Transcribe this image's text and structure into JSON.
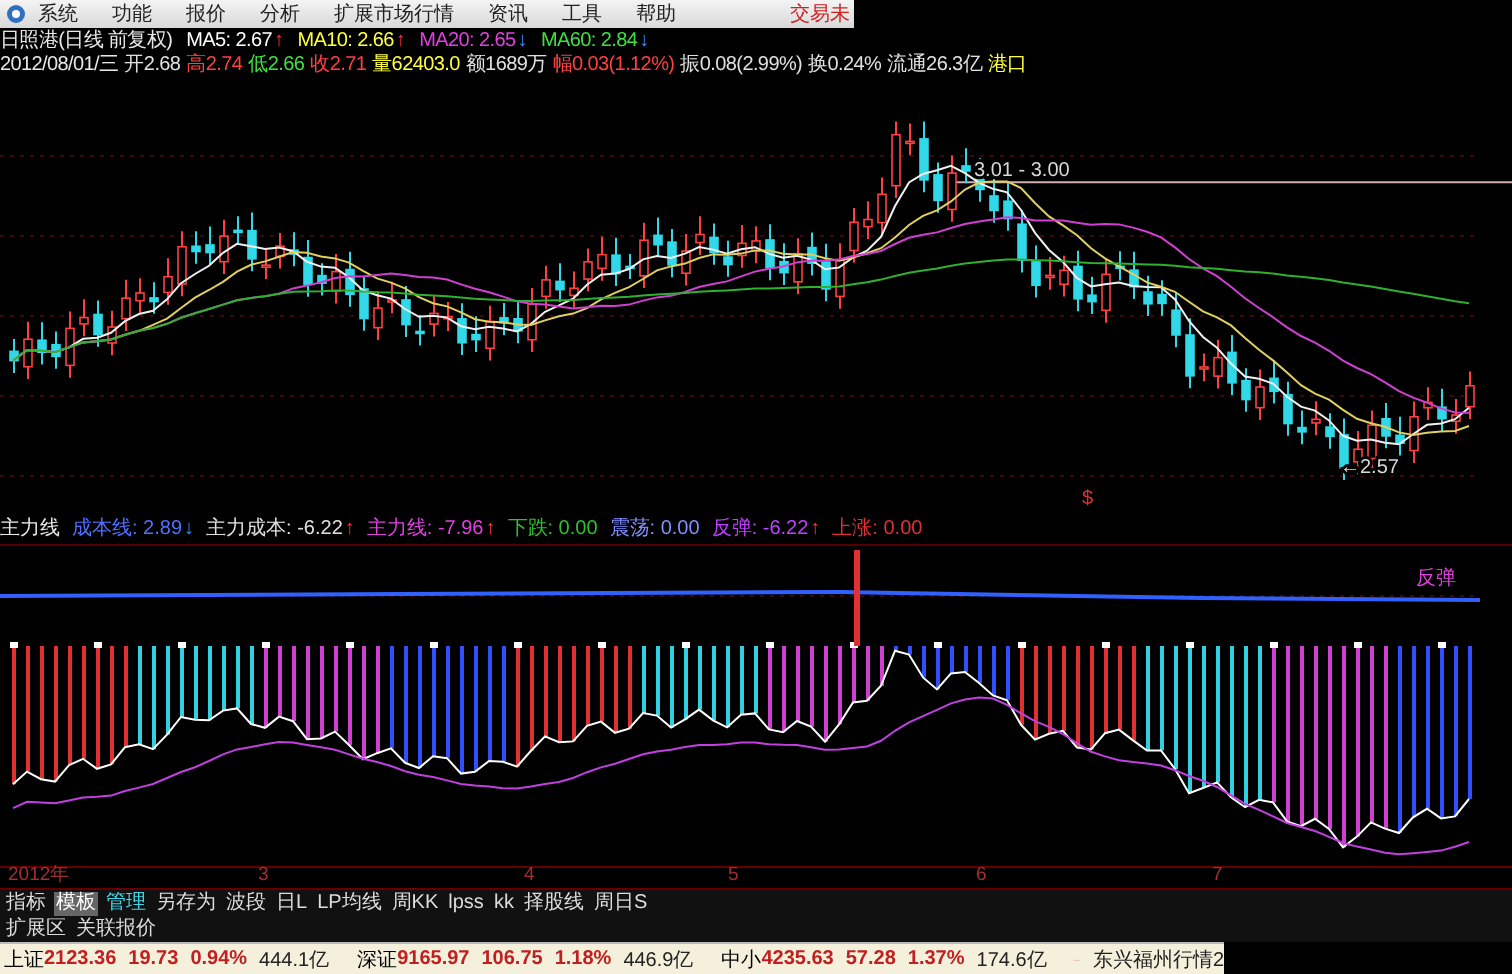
{
  "menu": {
    "items": [
      "系统",
      "功能",
      "报价",
      "分析",
      "扩展市场行情",
      "资讯",
      "工具",
      "帮助"
    ],
    "status": "交易未"
  },
  "header": {
    "title": "日照港(日线 前复权)",
    "moving_averages": [
      {
        "label": "MA5: 2.67",
        "color": "#ffffff",
        "arrow": "↑",
        "rising": true
      },
      {
        "label": "MA10: 2.66",
        "color": "#ffff40",
        "arrow": "↑",
        "rising": true
      },
      {
        "label": "MA20: 2.65",
        "color": "#e040e0",
        "arrow": "↓",
        "rising": false
      },
      {
        "label": "MA60: 2.84",
        "color": "#40e040",
        "arrow": "↓",
        "rising": false
      }
    ]
  },
  "quote_line": {
    "date": "2012/08/01/三",
    "fields": [
      {
        "text": "开2.68",
        "color": "#e0e0e0"
      },
      {
        "text": "高2.74",
        "color": "#ff4040"
      },
      {
        "text": "低2.66",
        "color": "#40e040"
      },
      {
        "text": "收2.71",
        "color": "#ff4040"
      },
      {
        "text": "量62403.0",
        "color": "#ffff40"
      },
      {
        "text": "额1689万",
        "color": "#e0e0e0"
      },
      {
        "text": "幅0.03(1.12%)",
        "color": "#ff4040"
      },
      {
        "text": "振0.08(2.99%)",
        "color": "#e0e0e0"
      },
      {
        "text": "换0.24%",
        "color": "#e0e0e0"
      },
      {
        "text": "流通26.3亿",
        "color": "#e0e0e0"
      },
      {
        "text": "港口",
        "color": "#ffff40"
      }
    ]
  },
  "chart": {
    "annotations": [
      "3.01 - 3.00",
      "←2.57"
    ],
    "marker": "$"
  },
  "indicator": {
    "title": "主力线",
    "items": [
      {
        "label": "成本线:",
        "value": "2.89",
        "color": "#5070ff",
        "arrow": "↓",
        "rising": false
      },
      {
        "label": "主力成本:",
        "value": "-6.22",
        "color": "#e0e0e0",
        "arrow": "↑",
        "rising": true
      },
      {
        "label": "主力线:",
        "value": "-7.96",
        "color": "#e040e0",
        "arrow": "↑",
        "rising": true
      },
      {
        "label": "下跌:",
        "value": "0.00",
        "color": "#30c030"
      },
      {
        "label": "震荡:",
        "value": "0.00",
        "color": "#8090ff"
      },
      {
        "label": "反弹:",
        "value": "-6.22",
        "color": "#c040ff",
        "arrow": "↑",
        "rising": true
      },
      {
        "label": "上涨:",
        "value": "0.00",
        "color": "#e03030"
      }
    ],
    "legend": "反弹"
  },
  "date_axis": [
    "2012年",
    "3",
    "4",
    "5",
    "6",
    "7"
  ],
  "toolbar": {
    "tabs": [
      {
        "label": "指标",
        "selected": false,
        "highlighted": false
      },
      {
        "label": "模板",
        "selected": true,
        "highlighted": false
      },
      {
        "label": "管理",
        "selected": false,
        "highlighted": true
      },
      {
        "label": "另存为",
        "selected": false,
        "highlighted": false
      },
      {
        "label": "波段",
        "selected": false,
        "highlighted": false
      },
      {
        "label": "日L",
        "selected": false,
        "highlighted": false
      },
      {
        "label": "LP均线",
        "selected": false,
        "highlighted": false
      },
      {
        "label": "周KK",
        "selected": false,
        "highlighted": false
      },
      {
        "label": "lpss",
        "selected": false,
        "highlighted": false
      },
      {
        "label": "kk",
        "selected": false,
        "highlighted": false
      },
      {
        "label": "择股线",
        "selected": false,
        "highlighted": false
      },
      {
        "label": "周日S",
        "selected": false,
        "highlighted": false
      }
    ],
    "extra": [
      "扩展区",
      "关联报价"
    ]
  },
  "status_bar": {
    "indices": [
      {
        "name": "上证",
        "value": "2123.36",
        "change": "19.73",
        "percent": "0.94%",
        "amount": "444.1亿"
      },
      {
        "name": "深证",
        "value": "9165.97",
        "change": "106.75",
        "percent": "1.18%",
        "amount": "446.9亿"
      },
      {
        "name": "中小",
        "value": "4235.63",
        "change": "57.28",
        "percent": "1.37%",
        "amount": "174.6亿"
      }
    ],
    "feed": "东兴福州行情2"
  }
}
